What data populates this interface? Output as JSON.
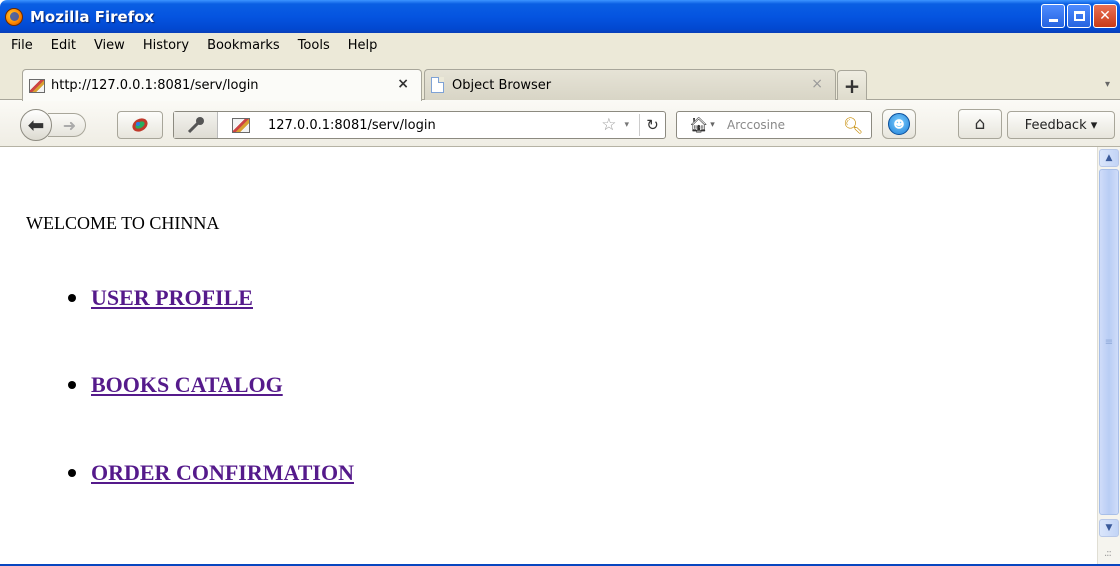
{
  "window": {
    "title": "Mozilla Firefox",
    "icon": "firefox-icon",
    "controls": {
      "minimize": "minimize-icon",
      "maximize": "maximize-icon",
      "close": "close-icon",
      "close_glyph": "✕"
    }
  },
  "menu": {
    "items": [
      {
        "label": "File",
        "accel": "F"
      },
      {
        "label": "Edit",
        "accel": "E"
      },
      {
        "label": "View",
        "accel": "V"
      },
      {
        "label": "History",
        "accel": "s"
      },
      {
        "label": "Bookmarks",
        "accel": "B"
      },
      {
        "label": "Tools",
        "accel": "T"
      },
      {
        "label": "Help",
        "accel": "H"
      }
    ]
  },
  "tabs": [
    {
      "label": "http://127.0.0.1:8081/serv/login",
      "active": true,
      "close": "×"
    },
    {
      "label": "Object Browser",
      "active": false,
      "close": "×"
    }
  ],
  "new_tab_label": "+",
  "nav": {
    "url": "127.0.0.1:8081/serv/login",
    "search_placeholder": "Arccosine",
    "feedback_label": "Feedback ▾"
  },
  "page": {
    "welcome": "WELCOME TO CHINNA",
    "links": [
      {
        "label": "USER PROFILE"
      },
      {
        "label": "BOOKS CATALOG"
      },
      {
        "label": "ORDER CONFIRMATION"
      }
    ],
    "link_color": "#551a8b"
  },
  "colors": {
    "titlebar": "#0554e0",
    "chrome": "#ece9d8",
    "scroll_thumb": "#c2d4f6"
  }
}
